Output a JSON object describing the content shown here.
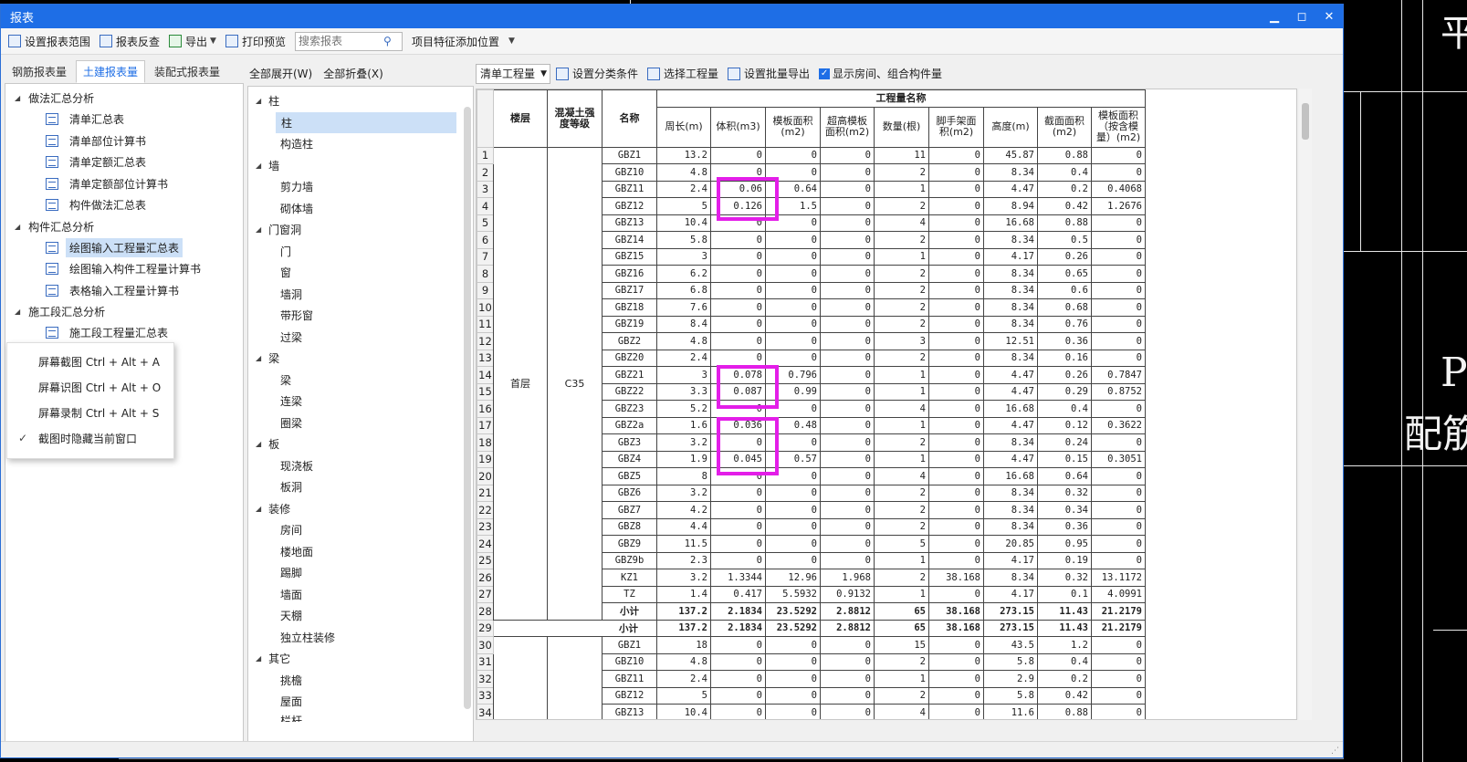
{
  "window": {
    "title": "报表",
    "buttons": [
      "▁",
      "◻",
      "✕"
    ]
  },
  "background_cad": {
    "text1": "平",
    "text2": "P",
    "text3": "配筋"
  },
  "toolbar": [
    {
      "label": "设置报表范围",
      "icon": "range-icon"
    },
    {
      "label": "报表反查",
      "icon": "reverse-lookup-icon"
    },
    {
      "label": "导出",
      "icon": "export-icon",
      "dropdown": true
    },
    {
      "label": "打印预览",
      "icon": "print-preview-icon"
    }
  ],
  "search": {
    "placeholder": "搜索报表"
  },
  "project_feature": {
    "label": "项目特征添加位置"
  },
  "left_tabs": [
    "钢筋报表量",
    "土建报表量",
    "装配式报表量"
  ],
  "left_tree": [
    {
      "group": "做法汇总分析",
      "items": [
        "清单汇总表",
        "清单部位计算书",
        "清单定额汇总表",
        "清单定额部位计算书",
        "构件做法汇总表"
      ]
    },
    {
      "group": "构件汇总分析",
      "items": [
        "绘图输入工程量汇总表",
        "绘图输入构件工程量计算书",
        "表格输入工程量计算书"
      ]
    },
    {
      "group": "施工段汇总分析",
      "items": [
        "施工段工程量汇总表"
      ]
    }
  ],
  "popup_menu": [
    "屏幕截图 Ctrl + Alt + A",
    "屏幕识图 Ctrl + Alt + O",
    "屏幕录制 Ctrl + Alt + S",
    "截图时隐藏当前窗口"
  ],
  "mid_bar": {
    "expand": "全部展开(W)",
    "collapse": "全部折叠(X)"
  },
  "mid_tree": [
    {
      "group": "柱",
      "items": [
        "柱",
        "构造柱"
      ]
    },
    {
      "group": "墙",
      "items": [
        "剪力墙",
        "砌体墙"
      ]
    },
    {
      "group": "门窗洞",
      "items": [
        "门",
        "窗",
        "墙洞",
        "带形窗",
        "过梁"
      ]
    },
    {
      "group": "梁",
      "items": [
        "梁",
        "连梁",
        "圈梁"
      ]
    },
    {
      "group": "板",
      "items": [
        "现浇板",
        "板洞"
      ]
    },
    {
      "group": "装修",
      "items": [
        "房间",
        "楼地面",
        "踢脚",
        "墙面",
        "天棚",
        "独立柱装修"
      ]
    },
    {
      "group": "其它",
      "items": [
        "挑檐",
        "屋面",
        "栏杆"
      ]
    }
  ],
  "right_toolbar": {
    "combo": "清单工程量",
    "filter": "设置分类条件",
    "select": "选择工程量",
    "batch_export": "设置批量导出",
    "show_rooms": "显示房间、组合构件量"
  },
  "table": {
    "header_group": "工程量名称",
    "col_floor": "楼层",
    "col_grade": "混凝土强度等级",
    "col_name": "名称",
    "cols": [
      "周长(m)",
      "体积(m3)",
      "模板面积(m2)",
      "超高模板面积(m2)",
      "数量(根)",
      "脚手架面积(m2)",
      "高度(m)",
      "截面面积(m2)",
      "模板面积（按含模量）(m2)"
    ],
    "floor1": "首层",
    "grade1": "C35",
    "rows": [
      [
        "GBZ1",
        "13.2",
        "0",
        "0",
        "0",
        "11",
        "0",
        "45.87",
        "0.88",
        "0"
      ],
      [
        "GBZ10",
        "4.8",
        "0",
        "0",
        "0",
        "2",
        "0",
        "8.34",
        "0.4",
        "0"
      ],
      [
        "GBZ11",
        "2.4",
        "0.06",
        "0.64",
        "0",
        "1",
        "0",
        "4.47",
        "0.2",
        "0.4068"
      ],
      [
        "GBZ12",
        "5",
        "0.126",
        "1.5",
        "0",
        "2",
        "0",
        "8.94",
        "0.42",
        "1.2676"
      ],
      [
        "GBZ13",
        "10.4",
        "0",
        "0",
        "0",
        "4",
        "0",
        "16.68",
        "0.88",
        "0"
      ],
      [
        "GBZ14",
        "5.8",
        "0",
        "0",
        "0",
        "2",
        "0",
        "8.34",
        "0.5",
        "0"
      ],
      [
        "GBZ15",
        "3",
        "0",
        "0",
        "0",
        "1",
        "0",
        "4.17",
        "0.26",
        "0"
      ],
      [
        "GBZ16",
        "6.2",
        "0",
        "0",
        "0",
        "2",
        "0",
        "8.34",
        "0.65",
        "0"
      ],
      [
        "GBZ17",
        "6.8",
        "0",
        "0",
        "0",
        "2",
        "0",
        "8.34",
        "0.6",
        "0"
      ],
      [
        "GBZ18",
        "7.6",
        "0",
        "0",
        "0",
        "2",
        "0",
        "8.34",
        "0.68",
        "0"
      ],
      [
        "GBZ19",
        "8.4",
        "0",
        "0",
        "0",
        "2",
        "0",
        "8.34",
        "0.76",
        "0"
      ],
      [
        "GBZ2",
        "4.8",
        "0",
        "0",
        "0",
        "3",
        "0",
        "12.51",
        "0.36",
        "0"
      ],
      [
        "GBZ20",
        "2.4",
        "0",
        "0",
        "0",
        "2",
        "0",
        "8.34",
        "0.16",
        "0"
      ],
      [
        "GBZ21",
        "3",
        "0.078",
        "0.796",
        "0",
        "1",
        "0",
        "4.47",
        "0.26",
        "0.7847"
      ],
      [
        "GBZ22",
        "3.3",
        "0.087",
        "0.99",
        "0",
        "1",
        "0",
        "4.47",
        "0.29",
        "0.8752"
      ],
      [
        "GBZ23",
        "5.2",
        "0",
        "0",
        "0",
        "4",
        "0",
        "16.68",
        "0.4",
        "0"
      ],
      [
        "GBZ2a",
        "1.6",
        "0.036",
        "0.48",
        "0",
        "1",
        "0",
        "4.47",
        "0.12",
        "0.3622"
      ],
      [
        "GBZ3",
        "3.2",
        "0",
        "0",
        "0",
        "2",
        "0",
        "8.34",
        "0.24",
        "0"
      ],
      [
        "GBZ4",
        "1.9",
        "0.045",
        "0.57",
        "0",
        "1",
        "0",
        "4.47",
        "0.15",
        "0.3051"
      ],
      [
        "GBZ5",
        "8",
        "0",
        "0",
        "0",
        "4",
        "0",
        "16.68",
        "0.64",
        "0"
      ],
      [
        "GBZ6",
        "3.2",
        "0",
        "0",
        "0",
        "2",
        "0",
        "8.34",
        "0.32",
        "0"
      ],
      [
        "GBZ7",
        "4.2",
        "0",
        "0",
        "0",
        "2",
        "0",
        "8.34",
        "0.34",
        "0"
      ],
      [
        "GBZ8",
        "4.4",
        "0",
        "0",
        "0",
        "2",
        "0",
        "8.34",
        "0.36",
        "0"
      ],
      [
        "GBZ9",
        "11.5",
        "0",
        "0",
        "0",
        "5",
        "0",
        "20.85",
        "0.95",
        "0"
      ],
      [
        "GBZ9b",
        "2.3",
        "0",
        "0",
        "0",
        "1",
        "0",
        "4.17",
        "0.19",
        "0"
      ],
      [
        "KZ1",
        "3.2",
        "1.3344",
        "12.96",
        "1.968",
        "2",
        "38.168",
        "8.34",
        "0.32",
        "13.1172"
      ],
      [
        "TZ",
        "1.4",
        "0.417",
        "5.5932",
        "0.9132",
        "1",
        "0",
        "4.17",
        "0.1",
        "4.0991"
      ]
    ],
    "subtotal_grade": [
      "小计",
      "137.2",
      "2.1834",
      "23.5292",
      "2.8812",
      "65",
      "38.168",
      "273.15",
      "11.43",
      "21.2179"
    ],
    "subtotal_floor": [
      "小计",
      "137.2",
      "2.1834",
      "23.5292",
      "2.8812",
      "65",
      "38.168",
      "273.15",
      "11.43",
      "21.2179"
    ],
    "rows2": [
      [
        "GBZ1",
        "18",
        "0",
        "0",
        "0",
        "15",
        "0",
        "43.5",
        "1.2",
        "0"
      ],
      [
        "GBZ10",
        "4.8",
        "0",
        "0",
        "0",
        "2",
        "0",
        "5.8",
        "0.4",
        "0"
      ],
      [
        "GBZ11",
        "2.4",
        "0",
        "0",
        "0",
        "1",
        "0",
        "2.9",
        "0.2",
        "0"
      ],
      [
        "GBZ12",
        "5",
        "0",
        "0",
        "0",
        "2",
        "0",
        "5.8",
        "0.42",
        "0"
      ],
      [
        "GBZ13",
        "10.4",
        "0",
        "0",
        "0",
        "4",
        "0",
        "11.6",
        "0.88",
        "0"
      ]
    ]
  }
}
